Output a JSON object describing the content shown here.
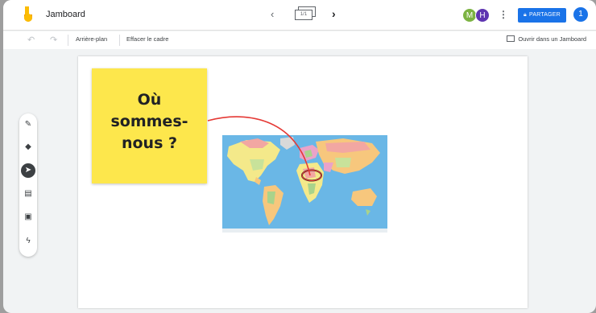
{
  "header": {
    "app_title": "Jamboard",
    "frame_counter": "1/1",
    "prev_icon": "‹",
    "next_icon": "›",
    "avatars": [
      "M",
      "H"
    ],
    "more_icon": "⋮",
    "share_label": "PARTAGER",
    "account_initial": "1"
  },
  "toolbar": {
    "undo_icon": "↶",
    "redo_icon": "↷",
    "background_label": "Arrière-plan",
    "clear_label": "Effacer le cadre",
    "open_label": "Ouvrir dans un Jamboard"
  },
  "canvas": {
    "sticky_note": {
      "lines": [
        "Où",
        "sommes-",
        "nous ?"
      ],
      "color": "#fde74c"
    },
    "map_image": "world-political-map",
    "annotation_color": "#e53935"
  },
  "tools": [
    {
      "name": "pen-icon",
      "glyph": "✎"
    },
    {
      "name": "eraser-icon",
      "glyph": "◆"
    },
    {
      "name": "select-icon",
      "glyph": "➤"
    },
    {
      "name": "sticky-note-icon",
      "glyph": "▤"
    },
    {
      "name": "image-icon",
      "glyph": "▣"
    },
    {
      "name": "laser-icon",
      "glyph": "ϟ"
    }
  ],
  "colors": {
    "accent": "#1a73e8",
    "sticky": "#fde74c",
    "annotation": "#e53935"
  }
}
